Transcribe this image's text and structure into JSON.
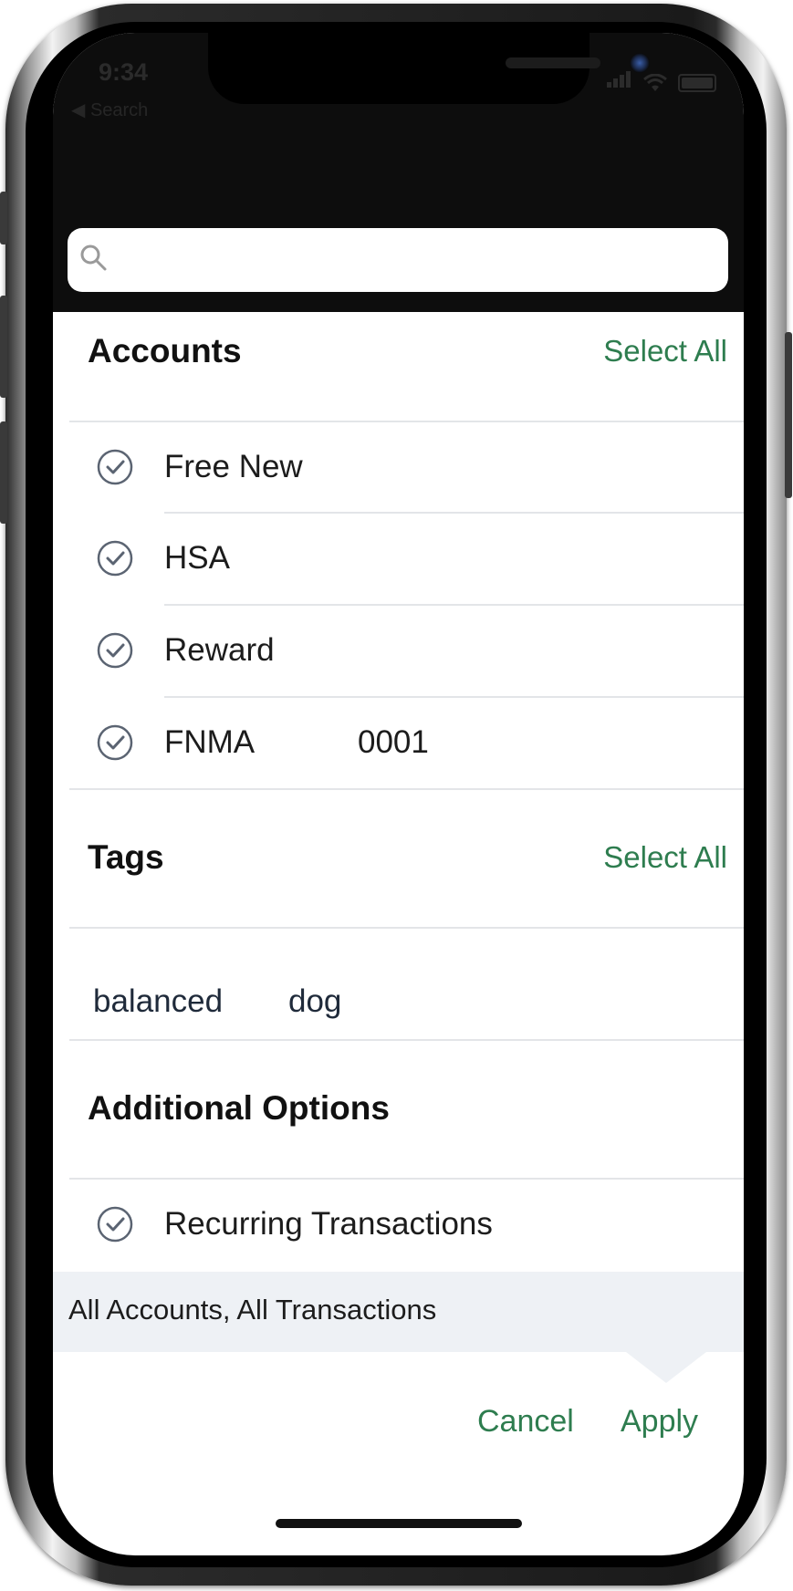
{
  "status_bar": {
    "time": "9:34",
    "back_label": "◀ Search"
  },
  "search": {
    "placeholder": ""
  },
  "accounts": {
    "title": "Accounts",
    "select_all": "Select All",
    "items": [
      {
        "label": "Free New",
        "extra": ""
      },
      {
        "label": "HSA",
        "extra": ""
      },
      {
        "label": "Reward",
        "extra": ""
      },
      {
        "label": "FNMA",
        "extra": "0001"
      }
    ]
  },
  "tags": {
    "title": "Tags",
    "select_all": "Select All",
    "items": [
      "balanced",
      "dog"
    ]
  },
  "additional_options": {
    "title": "Additional Options",
    "items": [
      {
        "label": "Recurring Transactions"
      }
    ]
  },
  "summary": {
    "text": "All Accounts, All Transactions"
  },
  "actions": {
    "cancel": "Cancel",
    "apply": "Apply"
  },
  "colors": {
    "accent": "#2e7d4f",
    "check": "#5b6472",
    "summary_bg": "#eef1f5"
  }
}
